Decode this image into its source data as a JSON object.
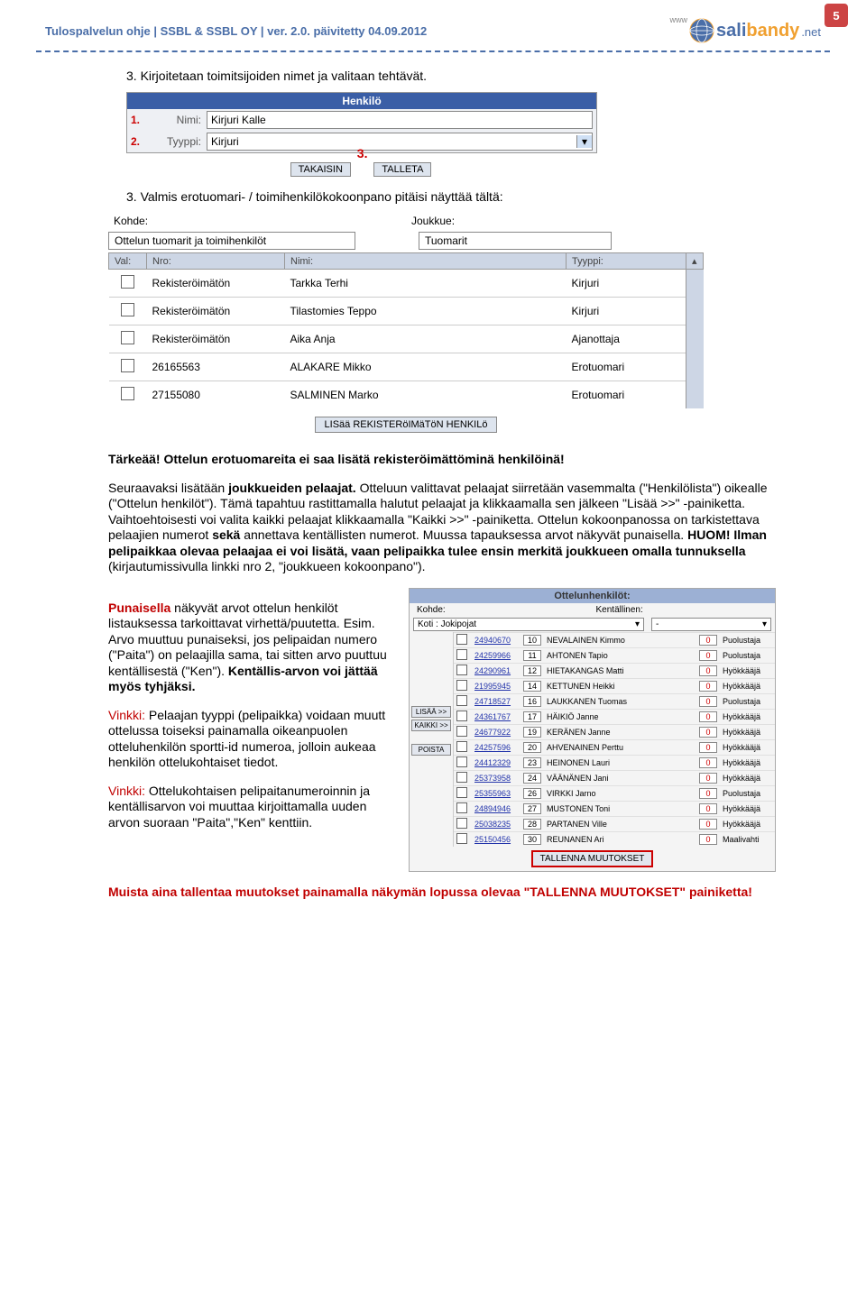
{
  "page_number": "5",
  "header": "Tulospalvelun ohje | SSBL & SSBL OY | ver. 2.0. päivitetty 04.09.2012",
  "logo": {
    "www": "www",
    "sali": "sali",
    "bandy": "bandy",
    "net": ".net"
  },
  "steps": {
    "s3": "3. Kirjoitetaan toimitsijoiden nimet ja valitaan tehtävät.",
    "s3b": "3. Valmis erotuomari- / toimihenkilökokoonpano pitäisi näyttää tältä:"
  },
  "henkilo": {
    "title": "Henkilö",
    "num1": "1.",
    "num2": "2.",
    "num3": "3.",
    "lbl_nimi": "Nimi:",
    "lbl_tyyppi": "Tyyppi:",
    "val_nimi": "Kirjuri Kalle",
    "val_tyyppi": "Kirjuri",
    "btn_back": "TAKAISIN",
    "btn_save": "TALLETA"
  },
  "tuomarit": {
    "kohde_lbl": "Kohde:",
    "joukkue_lbl": "Joukkue:",
    "kohde_val": "Ottelun tuomarit ja toimihenkilöt",
    "joukkue_val": "Tuomarit",
    "h_val": "Val:",
    "h_nro": "Nro:",
    "h_nimi": "Nimi:",
    "h_tyyppi": "Tyyppi:",
    "rows": [
      {
        "nro": "Rekisteröimätön",
        "nimi": "Tarkka Terhi",
        "tyyppi": "Kirjuri"
      },
      {
        "nro": "Rekisteröimätön",
        "nimi": "Tilastomies Teppo",
        "tyyppi": "Kirjuri"
      },
      {
        "nro": "Rekisteröimätön",
        "nimi": "Aika Anja",
        "tyyppi": "Ajanottaja"
      },
      {
        "nro": "26165563",
        "nimi": "ALAKARE Mikko",
        "tyyppi": "Erotuomari"
      },
      {
        "nro": "27155080",
        "nimi": "SALMINEN Marko",
        "tyyppi": "Erotuomari"
      }
    ],
    "lisaa_btn": "LISää REKISTERöIMäTöN HENKILö"
  },
  "text": {
    "tarkeaa": "Tärkeää! Ottelun erotuomareita ei saa lisätä rekisteröimättöminä henkilöinä!",
    "p1_a": "Seuraavaksi lisätään ",
    "p1_b": "joukkueiden pelaajat. ",
    "p1_c": "Otteluun valittavat pelaajat siirretään vasemmalta (\"Henkilölista\") oikealle (\"Ottelun henkilöt\"). Tämä tapahtuu rastittamalla halutut pelaajat ja klikkaamalla sen jälkeen \"Lisää >>\" -painiketta. Vaihtoehtoisesti voi valita kaikki pelaajat klikkaamalla \"Kaikki >>\" -painiketta. Ottelun kokoonpanossa on tarkistettava pelaajien numerot ",
    "p1_d": "sekä ",
    "p1_e": "annettava kentällisten numerot. Muussa tapauksessa arvot näkyvät punaisella. ",
    "p1_f": "HUOM! Ilman pelipaikkaa olevaa pelaajaa ei voi lisätä, vaan pelipaikka tulee ensin merkitä joukkueen omalla tunnuksella ",
    "p1_g": "(kirjautumissivulla linkki nro 2, \"joukkueen kokoonpano\").",
    "pun_a": "Punaisella ",
    "pun_b": "näkyvät arvot ottelun henkilöt listauksessa tarkoittavat virhettä/puutetta. Esim. Arvo muuttuu punaiseksi, jos pelipaidan numero (\"Paita\") on pelaajilla sama, tai sitten arvo puuttuu kentällisestä (\"Ken\"). ",
    "pun_c": "Kentällis-arvon voi jättää myös tyhjäksi.",
    "v1_a": "Vinkki: ",
    "v1_b": "Pelaajan tyyppi (pelipaikka) voidaan muutt ottelussa toiseksi painamalla oikeanpuolen otteluhenkilön sportti-id numeroa, jolloin aukeaa henkilön ottelukohtaiset tiedot.",
    "v2_a": "Vinkki: ",
    "v2_b": "Ottelukohtaisen pelipaitanumeroinnin ja kentällisarvon voi muuttaa kirjoittamalla uuden arvon suoraan \"Paita\",\"Ken\" kenttiin.",
    "footer": "Muista aina tallentaa muutokset painamalla näkymän lopussa olevaa \"TALLENNA MUUTOKSET\" painiketta!"
  },
  "roster": {
    "title": "Ottelunhenkilöt:",
    "kohde": "Kohde:",
    "kent": "Kentällinen:",
    "koti": "Koti : Jokipojat",
    "dash": "-",
    "rows": [
      {
        "id": "24940670",
        "p": "10",
        "n": "NEVALAINEN Kimmo",
        "k": "0",
        "t": "Puolustaja"
      },
      {
        "id": "24259966",
        "p": "11",
        "n": "AHTONEN Tapio",
        "k": "0",
        "t": "Puolustaja"
      },
      {
        "id": "24290961",
        "p": "12",
        "n": "HIETAKANGAS Matti",
        "k": "0",
        "t": "Hyökkääjä"
      },
      {
        "id": "21995945",
        "p": "14",
        "n": "KETTUNEN Heikki",
        "k": "0",
        "t": "Hyökkääjä"
      },
      {
        "id": "24718527",
        "p": "16",
        "n": "LAUKKANEN Tuomas",
        "k": "0",
        "t": "Puolustaja"
      },
      {
        "id": "24361767",
        "p": "17",
        "n": "HÄIKIÖ Janne",
        "k": "0",
        "t": "Hyökkääjä"
      },
      {
        "id": "24677922",
        "p": "19",
        "n": "KERÄNEN Janne",
        "k": "0",
        "t": "Hyökkääjä"
      },
      {
        "id": "24257596",
        "p": "20",
        "n": "AHVENAINEN Perttu",
        "k": "0",
        "t": "Hyökkääjä"
      },
      {
        "id": "24412329",
        "p": "23",
        "n": "HEINONEN Lauri",
        "k": "0",
        "t": "Hyökkääjä"
      },
      {
        "id": "25373958",
        "p": "24",
        "n": "VÄÄNÄNEN Jani",
        "k": "0",
        "t": "Hyökkääjä"
      },
      {
        "id": "25355963",
        "p": "26",
        "n": "VIRKKI Jarno",
        "k": "0",
        "t": "Puolustaja"
      },
      {
        "id": "24894946",
        "p": "27",
        "n": "MUSTONEN Toni",
        "k": "0",
        "t": "Hyökkääjä"
      },
      {
        "id": "25038235",
        "p": "28",
        "n": "PARTANEN Ville",
        "k": "0",
        "t": "Hyökkääjä"
      },
      {
        "id": "25150456",
        "p": "30",
        "n": "REUNANEN Ari",
        "k": "0",
        "t": "Maalivahti"
      }
    ],
    "btn_lisaa": "LISÄÄ >>",
    "btn_kaikki": "KAIKKI >>",
    "btn_poista": "POISTA",
    "btn_tallenna": "TALLENNA MUUTOKSET"
  }
}
